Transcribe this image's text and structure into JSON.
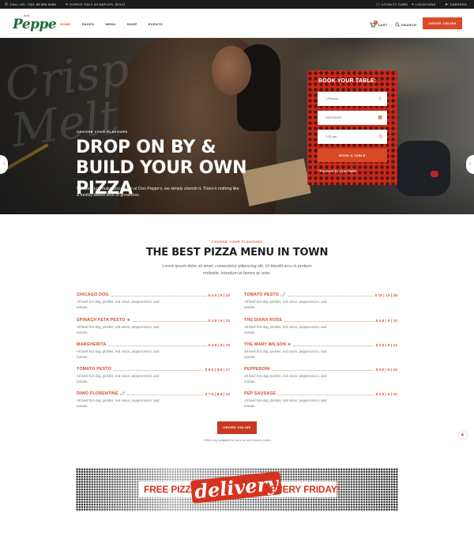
{
  "topbar": {
    "call": "CALL US: +391 65 866 8080",
    "address": "CORSO ITALY 64 NAPLES, 80121",
    "loyalty": "LOYALTY CARD",
    "locations": "LOCATIONS",
    "careers": "CAREERS"
  },
  "header": {
    "logo_small": "don",
    "logo_main": "Peppe",
    "nav": [
      "HOME",
      "PAGES",
      "MENU",
      "SHOP",
      "EVENTS"
    ],
    "cart_label": "CART",
    "cart_count": "0",
    "search_label": "SEARCH",
    "order_label": "ORDER ONLINE"
  },
  "hero": {
    "eyebrow": "CHOOSE YOUR FLAVOURS",
    "title": "DROP ON BY & BUILD YOUR OWN PIZZA",
    "description": "We don't just make pizza here at Don Peppe's, we simply cherish it. There's nothing like a freshly baked slice of greatness."
  },
  "booking": {
    "title": "BOOK YOUR TABLE:",
    "persons": "1 Person",
    "date": "12/27/2019",
    "time": "7:00 pm",
    "submit": "BOOK A TABLE",
    "powered": "*Powered by OpenTable"
  },
  "menu": {
    "kicker": "CHOOSE YOUR FLAVOURS",
    "title": "THE BEST PIZZA MENU IN TOWN",
    "subtitle": "Lorem ipsum dolor sit amet, consectetur adipiscing elit. Ut blandit arcu in pretium molestie. Interdum et fames ac ante.",
    "items": [
      {
        "name": "CHICAGO DOG",
        "price": "$ 4.5 | 9 | 10",
        "desc": "All beef hot dog, pickles, red onion, pepperoncini, and tomato."
      },
      {
        "name": "TOMATO PESTO",
        "price": "$ 11 | 13 | 18",
        "desc": "All beef hot dog, pickles, red onion, pepperoncini, and tomato."
      },
      {
        "name": "SPINACH FETA PESTO",
        "price": "$ 3.5 | 9 | 13",
        "desc": "All beef hot dog, pickles, red onion, pepperoncini, and tomato."
      },
      {
        "name": "THE DIANA ROSS",
        "price": "$ 4.5 | 9 | 10",
        "desc": "All beef hot dog, pickles, red onion, pepperoncini, and tomato."
      },
      {
        "name": "MARGHERITA",
        "price": "$ 4.5 | 9 | 10",
        "desc": "All beef hot dog, pickles, red onion, pepperoncini, and tomato."
      },
      {
        "name": "THE MARY WILSON",
        "price": "$ 3.5 | 9 | 13",
        "desc": "All beef hot dog, pickles, red onion, pepperoncini, and tomato."
      },
      {
        "name": "TOMATO PESTO",
        "price": "$ 9.5 | 6.5 | 17",
        "desc": "All beef hot dog, pickles, red onion, pepperoncini, and tomato."
      },
      {
        "name": "PEPPERONI",
        "price": "$ 4.5 | 9 | 10",
        "desc": "All beef hot dog, pickles, red onion, pepperoncini, and tomato."
      },
      {
        "name": "DIWO FLORENTINE",
        "price": "$ 7.5 | 8.5 | 10",
        "desc": "All beef hot dog, pickles, red onion, pepperoncini, and tomato."
      },
      {
        "name": "PEP SAUSAGE",
        "price": "$ 4.5 | 9 | 10",
        "desc": "All beef hot dog, pickles, red onion, pepperoncini, and tomato."
      }
    ],
    "order_label": "ORDER ONLINE",
    "disclaimer": "* Offers only available for carry out and delivery orders."
  },
  "banner": {
    "free": "FREE PIZZA",
    "delivery": "delivery",
    "friday": "EVERY FRIDAY!"
  },
  "colors": {
    "accent": "#d94a26",
    "brand_green": "#1e6b3a",
    "booking_red": "#c82a1d",
    "dark_bar": "#1c1c1c"
  }
}
